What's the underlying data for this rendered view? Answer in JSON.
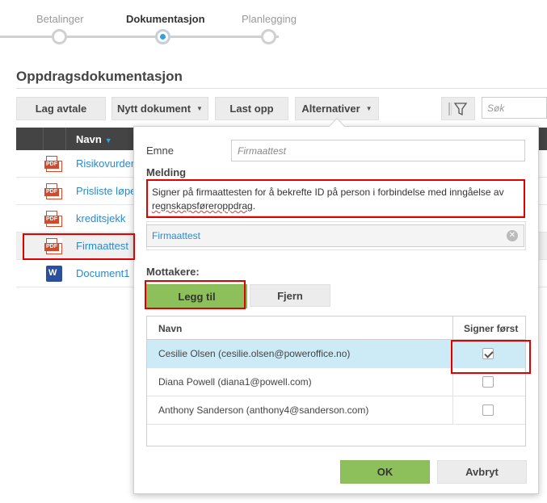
{
  "stepper": {
    "steps": [
      {
        "label": "Betalinger",
        "state": "done"
      },
      {
        "label": "Dokumentasjon",
        "state": "active"
      },
      {
        "label": "Planlegging",
        "state": "pending"
      }
    ]
  },
  "page": {
    "title": "Oppdragsdokumentasjon"
  },
  "toolbar": {
    "lag_avtale": "Lag avtale",
    "nytt_dokument": "Nytt dokument",
    "last_opp": "Last opp",
    "alternativer": "Alternativer",
    "search_placeholder": "Søk"
  },
  "grid": {
    "column_name": "Navn",
    "files": [
      {
        "name": "Risikovurdering",
        "type": "pdf"
      },
      {
        "name": "Prisliste løpen",
        "type": "pdf"
      },
      {
        "name": "kreditsjekk",
        "type": "pdf"
      },
      {
        "name": "Firmaattest",
        "type": "pdf",
        "selected": true
      },
      {
        "name": "Document1",
        "type": "word"
      }
    ]
  },
  "dialog": {
    "emne_label": "Emne",
    "emne_placeholder": "Firmaattest",
    "melding_label": "Melding",
    "message_text": "Signer på firmaattesten for å bekrefte ID på person i forbindelse med inngåelse av",
    "message_misspelled": "regnskapsføreroppdrag",
    "message_end": ".",
    "attachment": "Firmaattest",
    "mottakere_label": "Mottakere:",
    "legg_til": "Legg til",
    "fjern": "Fjern",
    "recipients_header_name": "Navn",
    "recipients_header_sign": "Signer først",
    "recipients": [
      {
        "name": "Cesilie Olsen (cesilie.olsen@poweroffice.no)",
        "sign_first": true
      },
      {
        "name": "Diana Powell (diana1@powell.com)",
        "sign_first": false
      },
      {
        "name": "Anthony Sanderson (anthony4@sanderson.com)",
        "sign_first": false
      }
    ],
    "ok": "OK",
    "avbryt": "Avbryt"
  },
  "icons": {
    "pdf": "PDF",
    "word": "W"
  },
  "colors": {
    "accent_blue": "#3ba0d8",
    "link_blue": "#2a8ad0",
    "green": "#8dc05a",
    "highlight_red": "#e00000",
    "row_highlight": "#cdeaf7"
  }
}
